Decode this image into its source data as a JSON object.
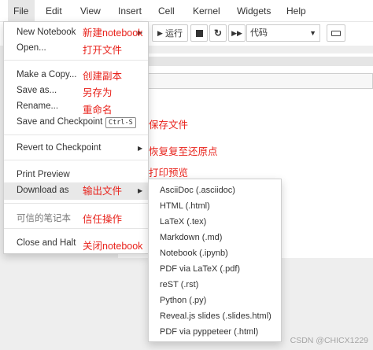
{
  "menubar": [
    "File",
    "Edit",
    "View",
    "Insert",
    "Cell",
    "Kernel",
    "Widgets",
    "Help"
  ],
  "toolbar": {
    "run_label": "运行",
    "cell_type": "代码"
  },
  "file_menu": {
    "new_notebook": "New Notebook",
    "open": "Open...",
    "make_copy": "Make a Copy...",
    "save_as": "Save as...",
    "rename": "Rename...",
    "save_checkpoint": "Save and Checkpoint",
    "save_shortcut": "Ctrl-S",
    "revert": "Revert to Checkpoint",
    "print_preview": "Print Preview",
    "download_as": "Download as",
    "trusted": "可信的笔记本",
    "close_halt": "Close and Halt"
  },
  "download_submenu": [
    "AsciiDoc (.asciidoc)",
    "HTML (.html)",
    "LaTeX (.tex)",
    "Markdown (.md)",
    "Notebook (.ipynb)",
    "PDF via LaTeX (.pdf)",
    "reST (.rst)",
    "Python (.py)",
    "Reveal.js slides (.slides.html)",
    "PDF via pyppeteer (.html)"
  ],
  "annotations": {
    "new": "新建notebook",
    "open": "打开文件",
    "copy": "创建副本",
    "saveas": "另存为",
    "rename": "重命名",
    "save": "保存文件",
    "revert": "恢复复至还原点",
    "print": "打印预览",
    "download": "输出文件",
    "trust": "信任操作",
    "close": "关闭notebook"
  },
  "watermark": "CSDN @CHICX1229",
  "colors": {
    "annotation": "#e8221b",
    "menu_highlight": "#e8e8e8"
  }
}
